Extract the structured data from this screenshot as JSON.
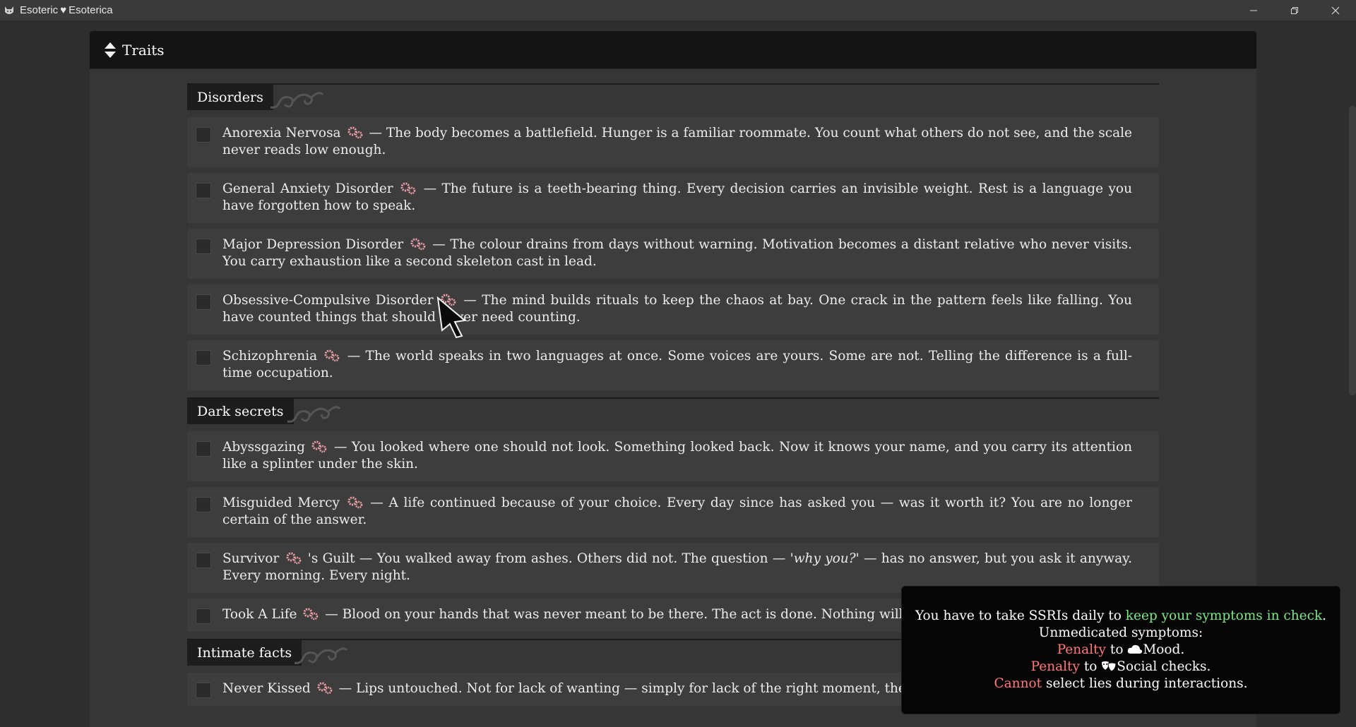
{
  "window": {
    "title_left": "Esoteric",
    "title_heart": "♥",
    "title_right": "Esoterica",
    "minimize": "—",
    "maximize": "❐",
    "close": "✕"
  },
  "panel": {
    "title": "Traits"
  },
  "sections": [
    {
      "name": "Disorders",
      "items": [
        {
          "name": "Anorexia Nervosa",
          "desc": " — The body becomes a battlefield. Hunger is a familiar roommate. You count what others do not see, and the scale never reads low enough."
        },
        {
          "name": "General Anxiety Disorder",
          "desc": " — The future is a teeth-bearing thing. Every decision carries an invisible weight. Rest is a language you have forgotten how to speak."
        },
        {
          "name": "Major Depression Disorder",
          "desc": " — The colour drains from days without warning. Motivation becomes a distant relative who never visits. You carry exhaustion like a second skeleton cast in lead."
        },
        {
          "name": "Obsessive-Compulsive Disorder",
          "desc": " — The mind builds rituals to keep the chaos at bay. One crack in the pattern feels like falling. You have counted things that should never need counting."
        },
        {
          "name": "Schizophrenia",
          "desc": " — The world speaks in two languages at once. Some voices are yours. Some are not. Telling the difference is a full-time occupation."
        }
      ]
    },
    {
      "name": "Dark secrets",
      "items": [
        {
          "name": "Abyssgazing",
          "desc": " — You looked where one should not look. Something looked back. Now it knows your name, and you carry its attention like a splinter under the skin."
        },
        {
          "name": "Misguided Mercy",
          "desc": " — A life continued because of your choice. Every day since has asked you — was it worth it? You are no longer certain of the answer."
        },
        {
          "name": "Survivor",
          "name_suffix": "'s Guilt",
          "desc": " — You walked away from ashes. Others did not. The question — ",
          "desc_italic": "'why you?'",
          "desc_end": " — has no answer, but you ask it anyway. Every morning. Every night."
        },
        {
          "name": "Took A Life",
          "desc": " — Blood on your hands that was never meant to be there. The act is done. Nothing will ever wa"
        }
      ]
    },
    {
      "name": "Intimate facts",
      "items": [
        {
          "name": "Never Kissed",
          "desc": " — Lips untouched. Not for lack of wanting — simply for lack of the right moment, the right p"
        }
      ]
    }
  ],
  "tooltip": {
    "line1_pre": "You have to take SSRIs daily to ",
    "line1_green": "keep your symptoms in check",
    "line1_post": ".",
    "line2": "Unmedicated symptoms:",
    "line3_red": "Penalty",
    "line3_mid": " to ",
    "line3_post": "Mood.",
    "line4_red": "Penalty",
    "line4_mid": " to ",
    "line4_post": "Social checks.",
    "line5_red": "Cannot",
    "line5_post": " select lies during interactions."
  },
  "colors": {
    "accent_green": "#7ee787",
    "penalty_red": "#ff7b7b",
    "trait_icon_pink": "#f0a0a8"
  }
}
